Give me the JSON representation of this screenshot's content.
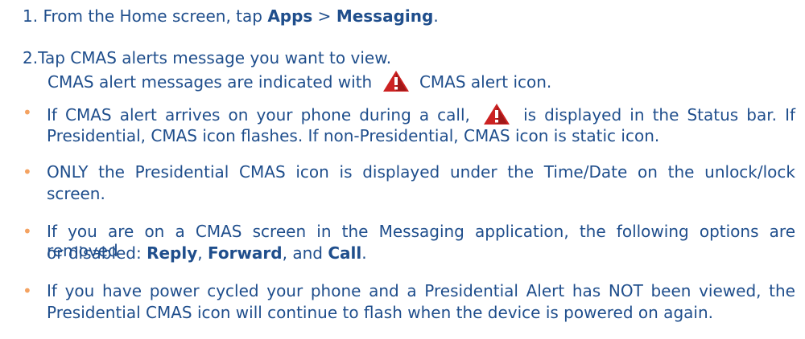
{
  "step1": {
    "num": "1.",
    "pre": " From the Home screen, tap ",
    "apps": "Apps",
    "gt": " > ",
    "messaging": "Messaging",
    "period": "."
  },
  "step2": {
    "num": "2.",
    "line1": "Tap CMAS alerts message you want to view.",
    "line2_pre": "CMAS alert messages are indicated with",
    "line2_post": "CMAS alert icon."
  },
  "bullets": {
    "b1_l1_pre": "If CMAS alert arrives on your phone during a call,",
    "b1_l1_post": "is displayed in the Status bar. If",
    "b1_l2": "Presidential, CMAS icon flashes. If non-Presidential, CMAS icon is static icon.",
    "b2_l1": "ONLY the Presidential CMAS icon is displayed under the Time/Date on the unlock/lock",
    "b2_l2": "screen.",
    "b3_l1": "If you are on a CMAS screen in the Messaging application, the following options are removed",
    "b3_l2_pre": "or disabled: ",
    "reply": "Reply",
    "comma1": ", ",
    "forward": "Forward",
    "and": ", and ",
    "call": "Call",
    "period": ".",
    "b4_l1": "If you have power cycled your phone and a Presidential Alert has NOT been viewed, the",
    "b4_l2": "Presidential CMAS icon will continue to flash when the device is powered on again."
  },
  "icons": {
    "alert": "cmas-alert-icon",
    "bullet": "•"
  },
  "colors": {
    "text": "#1f4e8c",
    "bullet": "#f4a261",
    "alert": "#cc2222"
  }
}
